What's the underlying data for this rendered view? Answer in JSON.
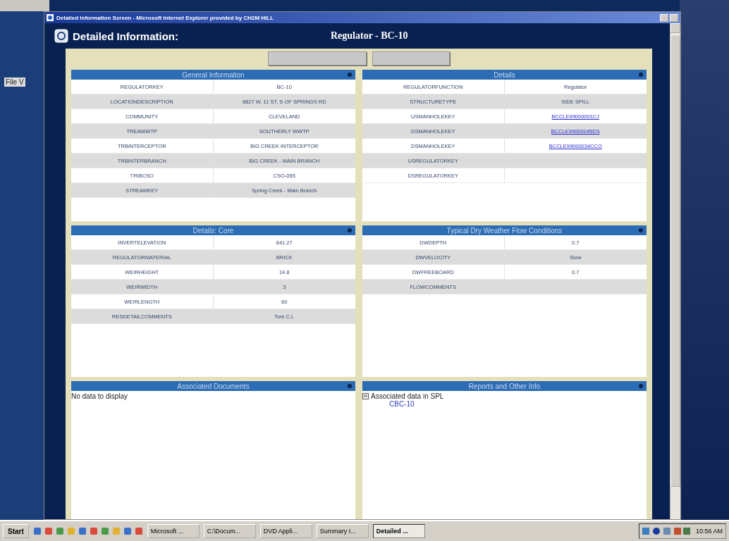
{
  "background_app": {
    "menu": "File V"
  },
  "window": {
    "title": "Detailed Information Screen - Microsoft Internet Explorer provided by CH2M HILL"
  },
  "header": {
    "title": "Detailed Information:",
    "subject": "Regulator - BC-10"
  },
  "sections": [
    {
      "title": "General Information",
      "kind": "table",
      "rows": [
        {
          "label": "REGULATORKEY",
          "value": "BC-10"
        },
        {
          "label": "LOCATIONDESCRIPTION",
          "value": "6827 W. 11 ST, S OF SPRINGS RD"
        },
        {
          "label": "COMMUNITY",
          "value": "CLEVELAND"
        },
        {
          "label": "TREAWWTP",
          "value": "SOUTHERLY WWTP"
        },
        {
          "label": "TRBINTERCEPTOR",
          "value": "BIG CREEK INTERCEPTOR"
        },
        {
          "label": "TRBINTERBRANCH",
          "value": "BIG CREEK - MAIN BRANCH"
        },
        {
          "label": "TRIBCSO",
          "value": "CSO-055"
        },
        {
          "label": "STREAMKEY",
          "value": "Spring Creek - Main Branch"
        }
      ]
    },
    {
      "title": "Details",
      "kind": "table",
      "rows": [
        {
          "label": "REGULATORFUNCTION",
          "value": "Regulator"
        },
        {
          "label": "STRUCTURETYPE",
          "value": "SIDE SPILL"
        },
        {
          "label": "USMANHOLEKEY",
          "link": "BCCLE99000001CJ"
        },
        {
          "label": "DSMANHOLEKEY",
          "link": "BCCLE99000045DS"
        },
        {
          "label": "DSMANHOLEKEY",
          "link": "BCCLE99000034CCO"
        },
        {
          "label": "USREGULATORKEY"
        },
        {
          "label": "DSREGULATORKEY"
        }
      ]
    },
    {
      "title": "Details: Core",
      "kind": "table",
      "rows": [
        {
          "label": "INVERTELEVATION",
          "value": "641.27"
        },
        {
          "label": "REGULATORMATERIAL",
          "value": "BRICK"
        },
        {
          "label": "WEIRHEIGHT",
          "value": "14.8"
        },
        {
          "label": "WEIRWIDTH",
          "value": "3"
        },
        {
          "label": "WEIRLENGTH",
          "value": "60"
        },
        {
          "label": "RESDETAILCOMMENTS",
          "value": "Tom C.I."
        }
      ]
    },
    {
      "title": "Typical Dry Weather Flow Conditions",
      "kind": "table",
      "rows": [
        {
          "label": "DWDEPTH",
          "value": "0.7"
        },
        {
          "label": "DWVELOCITY",
          "value": "Slow"
        },
        {
          "label": "DWFREEBOARD",
          "value": "0.7"
        },
        {
          "label": "FLOWCOMMENTS"
        }
      ]
    },
    {
      "title": "Associated Documents",
      "kind": "text",
      "text": "No data to display"
    },
    {
      "title": "Reports and Other Info",
      "kind": "reports",
      "text": "Associated data in SPL",
      "link": "CBC-10"
    }
  ],
  "taskbar": {
    "start": "Start",
    "tasks": [
      {
        "label": "Microsoft ...",
        "selected": false
      },
      {
        "label": "C:\\Docum...",
        "selected": false
      },
      {
        "label": "DVD Appli...",
        "selected": false
      },
      {
        "label": "Summary I...",
        "selected": false
      },
      {
        "label": "Detailed ...",
        "selected": true
      }
    ],
    "clock": "10:56 AM"
  }
}
